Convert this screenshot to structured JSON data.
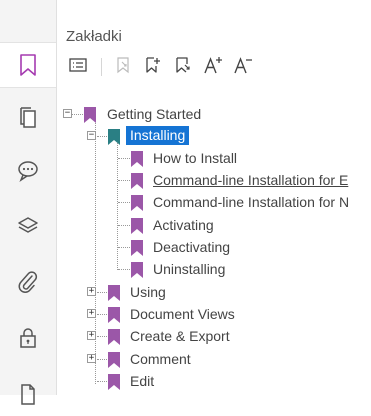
{
  "panel": {
    "title": "Zakładki"
  },
  "rail": {
    "items": [
      {
        "icon": "bookmark-icon",
        "active": true
      },
      {
        "icon": "pages-icon",
        "active": false
      },
      {
        "icon": "comment-icon",
        "active": false
      },
      {
        "icon": "layers-icon",
        "active": false
      },
      {
        "icon": "attachment-icon",
        "active": false
      },
      {
        "icon": "lock-icon",
        "active": false
      },
      {
        "icon": "document-icon",
        "active": false
      }
    ]
  },
  "toolbar": {
    "buttons": [
      "options-menu-icon",
      "new-bookmark-disabled-icon",
      "add-bookmark-icon",
      "add-bookmark-child-icon",
      "increase-text-size-icon",
      "decrease-text-size-icon"
    ]
  },
  "colors": {
    "bookmark": "#9b57a8",
    "bookmark_selected": "#2a7f84",
    "selection": "#1574d4",
    "rail_active_icon": "#a53bb0"
  },
  "tree": {
    "items": [
      {
        "label": "Getting Started",
        "level": 0,
        "toggle": "−"
      },
      {
        "label": "Installing",
        "level": 1,
        "toggle": "−",
        "selected": true
      },
      {
        "label": "How to Install",
        "level": 2
      },
      {
        "label": "Command-line Installation for E",
        "level": 2,
        "underlined": true
      },
      {
        "label": "Command-line Installation for N",
        "level": 2
      },
      {
        "label": "Activating",
        "level": 2
      },
      {
        "label": "Deactivating",
        "level": 2
      },
      {
        "label": "Uninstalling",
        "level": 2
      },
      {
        "label": "Using",
        "level": 1,
        "toggle": "+"
      },
      {
        "label": "Document Views",
        "level": 1,
        "toggle": "+"
      },
      {
        "label": "Create & Export",
        "level": 1,
        "toggle": "+"
      },
      {
        "label": "Comment",
        "level": 1,
        "toggle": "+"
      },
      {
        "label": "Edit",
        "level": 1
      }
    ]
  }
}
